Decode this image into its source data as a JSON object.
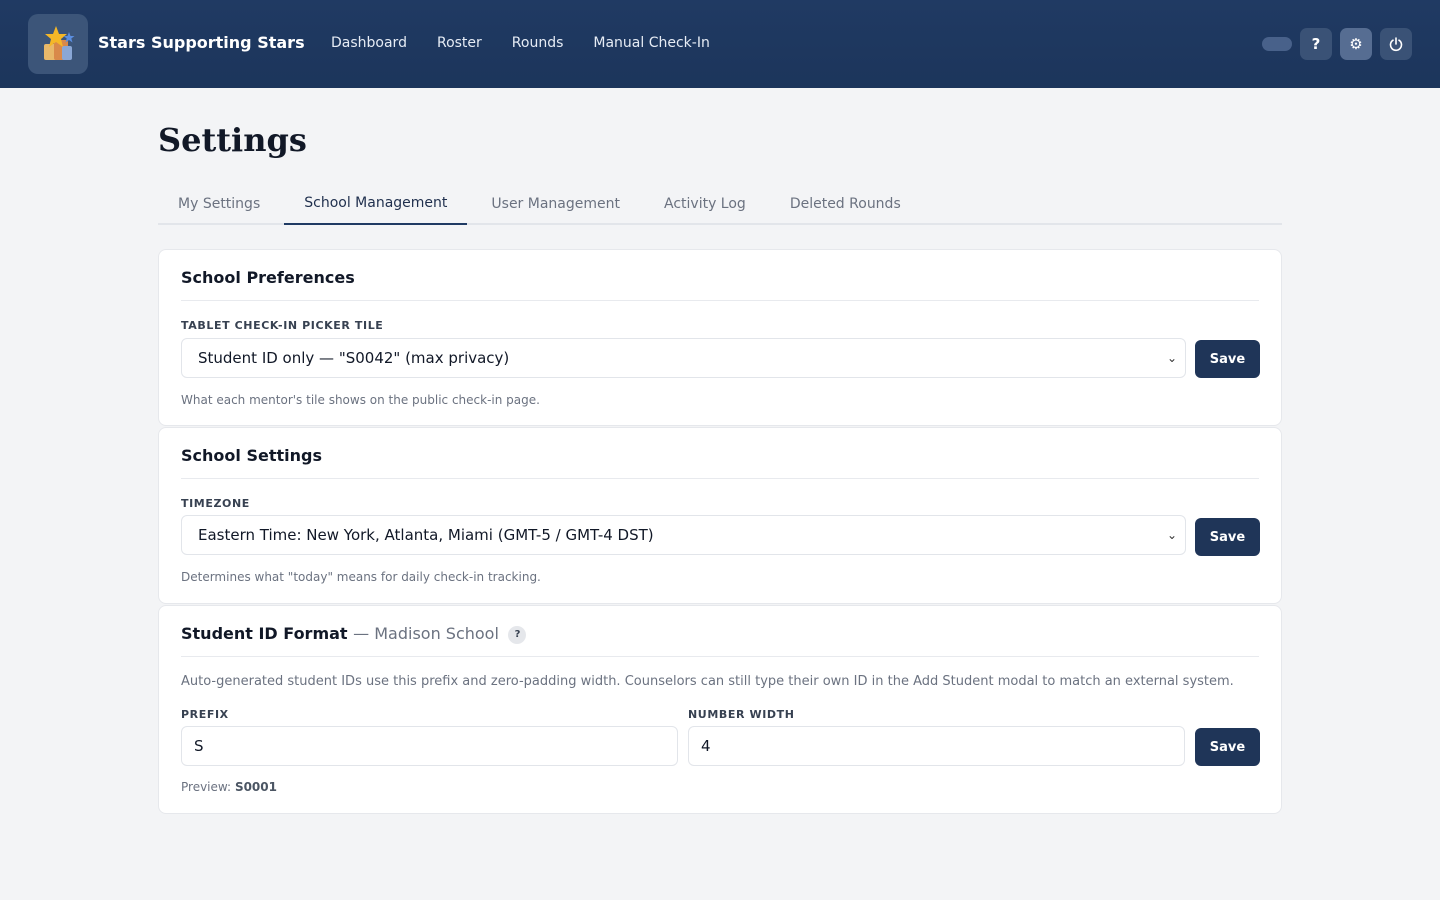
{
  "app": {
    "brand": "Stars Supporting Stars",
    "nav": [
      "Dashboard",
      "Roster",
      "Rounds",
      "Manual Check-In"
    ],
    "icons": [
      "toggle-icon",
      "help-icon",
      "gear-icon",
      "power-icon"
    ],
    "help_glyph": "?",
    "gear_glyph": "⚙",
    "power_glyph": "⏻"
  },
  "page": {
    "title": "Settings",
    "tabs": [
      "My Settings",
      "School Management",
      "User Management",
      "Activity Log",
      "Deleted Rounds"
    ],
    "active_tab": "School Management"
  },
  "preferences": {
    "title": "School Preferences",
    "label": "TABLET CHECK-IN PICKER TILE",
    "value": "Student ID only — \"S0042\" (max privacy)",
    "hint": "What each mentor's tile shows on the public check-in page.",
    "save": "Save"
  },
  "school_settings": {
    "title": "School Settings",
    "label": "TIMEZONE",
    "value": "Eastern Time: New York, Atlanta, Miami (GMT-5 / GMT-4 DST)",
    "hint": "Determines what \"today\" means for daily check-in tracking.",
    "save": "Save"
  },
  "id_format": {
    "title": "Student ID Format",
    "school": "— Madison School",
    "help": "?",
    "description": "Auto-generated student IDs use this prefix and zero-padding width. Counselors can still type their own ID in the Add Student modal to match an external system.",
    "prefix_label": "PREFIX",
    "prefix_value": "S",
    "width_label": "NUMBER WIDTH",
    "width_value": "4",
    "save": "Save",
    "preview_label": "Preview:",
    "preview_value": "S0001"
  },
  "colors": {
    "header": "#203a63",
    "primary_button": "#1f3558",
    "background": "#f3f4f6"
  }
}
